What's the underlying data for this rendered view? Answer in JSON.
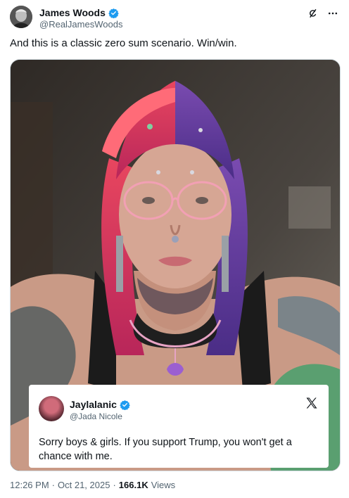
{
  "author": {
    "name": "James Woods",
    "handle": "@RealJamesWoods"
  },
  "tweet": {
    "text": "And this is a classic zero sum scenario. Win/win."
  },
  "quoted_card": {
    "name": "Jaylalanic",
    "handle": "@Jada Nicole",
    "text": "Sorry boys & girls. If you support Trump, you won't get a chance with me."
  },
  "meta": {
    "time": "12:26 PM",
    "separator1": "·",
    "date": "Oct 21, 2025",
    "separator2": "·",
    "views_count": "166.1K",
    "views_label": "Views"
  },
  "colors": {
    "verified": "#1d9bf0",
    "text_primary": "#0f1419",
    "text_secondary": "#536471"
  },
  "icons": {
    "grok": "grok-icon",
    "more": "more-icon",
    "verified": "verified-badge-icon",
    "x_logo": "x-logo-icon"
  }
}
